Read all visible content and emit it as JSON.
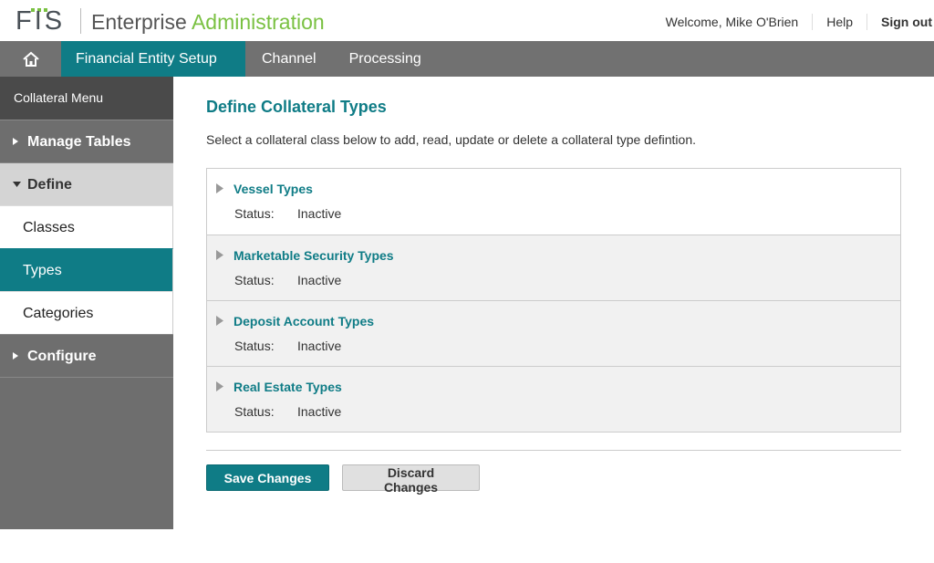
{
  "header": {
    "logo_text": "FIS",
    "title_part1": "Enterprise",
    "title_part2": "Administration",
    "welcome": "Welcome, Mike O'Brien",
    "help": "Help",
    "sign_out": "Sign out"
  },
  "topnav": {
    "home_icon": "home-icon",
    "tabs": [
      {
        "label": "Financial Entity Setup",
        "active": true
      },
      {
        "label": "Channel",
        "active": false
      },
      {
        "label": "Processing",
        "active": false
      }
    ]
  },
  "sidebar": {
    "heading": "Collateral Menu",
    "items": [
      {
        "label": "Manage Tables"
      },
      {
        "label": "Define"
      },
      {
        "label": "Configure"
      }
    ],
    "define_subitems": [
      {
        "label": "Classes"
      },
      {
        "label": "Types"
      },
      {
        "label": "Categories"
      }
    ]
  },
  "main": {
    "title": "Define Collateral Types",
    "description": "Select a collateral class below to add, read, update or delete a collateral type defintion.",
    "types": [
      {
        "name": "Vessel Types",
        "status_label": "Status:",
        "status": "Inactive"
      },
      {
        "name": "Marketable Security Types",
        "status_label": "Status:",
        "status": "Inactive"
      },
      {
        "name": "Deposit Account Types",
        "status_label": "Status:",
        "status": "Inactive"
      },
      {
        "name": "Real Estate Types",
        "status_label": "Status:",
        "status": "Inactive"
      }
    ],
    "save_label": "Save Changes",
    "discard_label": "Discard Changes"
  },
  "colors": {
    "accent": "#0f7c86",
    "brand_green": "#7ac142",
    "nav_gray": "#717171"
  }
}
